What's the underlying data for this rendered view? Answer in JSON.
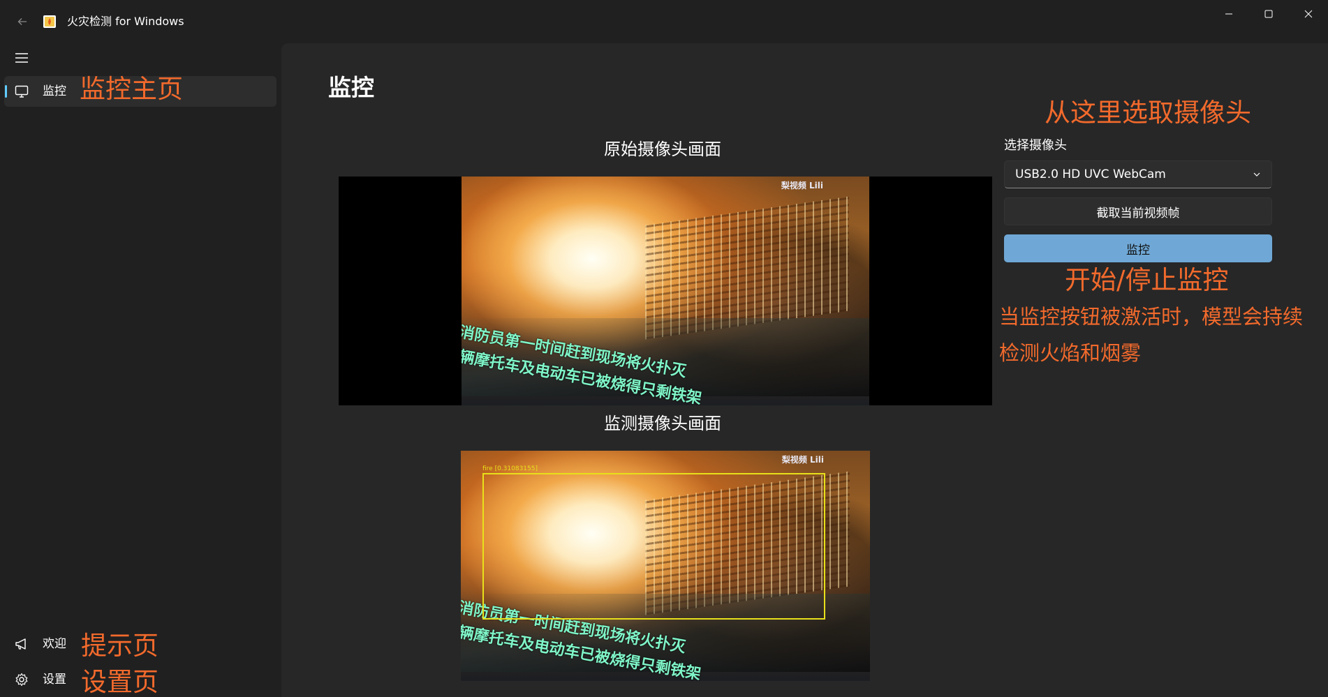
{
  "window": {
    "title": "火灾检测 for Windows",
    "back_icon": "back-arrow-icon",
    "minimize_icon": "minimize-icon",
    "maximize_icon": "maximize-icon",
    "close_icon": "close-icon"
  },
  "sidebar": {
    "menu_icon": "hamburger-icon",
    "items": [
      {
        "label": "监控",
        "icon": "monitor-icon",
        "selected": true
      },
      {
        "label": "欢迎",
        "icon": "megaphone-icon",
        "selected": false
      },
      {
        "label": "设置",
        "icon": "gear-icon",
        "selected": false
      }
    ]
  },
  "annotations": {
    "monitor_home": "监控主页",
    "tips_page": "提示页",
    "settings_page": "设置页",
    "select_camera_hint": "从这里选取摄像头",
    "start_stop": "开始/停止监控",
    "monitor_explain_line1": "当监控按钮被激活时，模型会持续",
    "monitor_explain_line2": "检测火焰和烟雾"
  },
  "main": {
    "page_title": "监控",
    "original_feed_heading": "原始摄像头画面",
    "detected_feed_heading": "监测摄像头画面",
    "original_subtitle_line1": "消防员第一时间赶到现场将火扑灭",
    "original_subtitle_line2": "辆摩托车及电动车已被烧得只剩铁架",
    "watermark": "梨视频 Lili",
    "detection_label": "fire [0.31083155]"
  },
  "panel": {
    "camera_label": "选择摄像头",
    "camera_selected": "USB2.0 HD UVC WebCam",
    "grab_frame_button": "截取当前视频帧",
    "monitor_button": "监控"
  },
  "colors": {
    "background": "#202020",
    "content": "#272727",
    "accent": "#60cdff",
    "monitor_button": "#6fa8d6",
    "annotation": "#f26a2c",
    "detection_box": "#e8e01a"
  }
}
